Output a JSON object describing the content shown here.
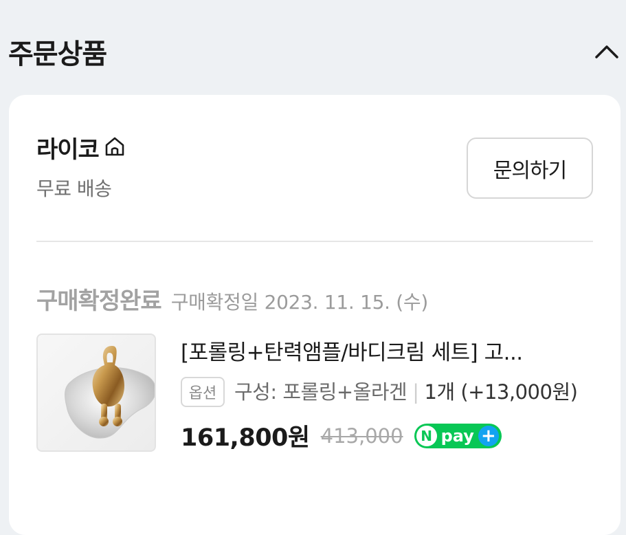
{
  "header": {
    "title": "주문상품"
  },
  "seller": {
    "name": "라이코",
    "shipping": "무료 배송",
    "inquiry_label": "문의하기"
  },
  "order": {
    "status": "구매확정완료",
    "confirm_date": "구매확정일 2023. 11. 15. (수)"
  },
  "product": {
    "name": "[포롤링+탄력앰플/바디크림 세트] 고...",
    "option_badge": "옵션",
    "option_text": "구성: 포롤링+올라겐",
    "quantity_text": "1개 (+13,000원)",
    "price": "161,800원",
    "original_price": "413,000",
    "npay_logo_text": "pay"
  },
  "colors": {
    "background": "#eef1f4",
    "npay_green": "#08c755",
    "npay_plus_blue": "#12a3f0"
  }
}
